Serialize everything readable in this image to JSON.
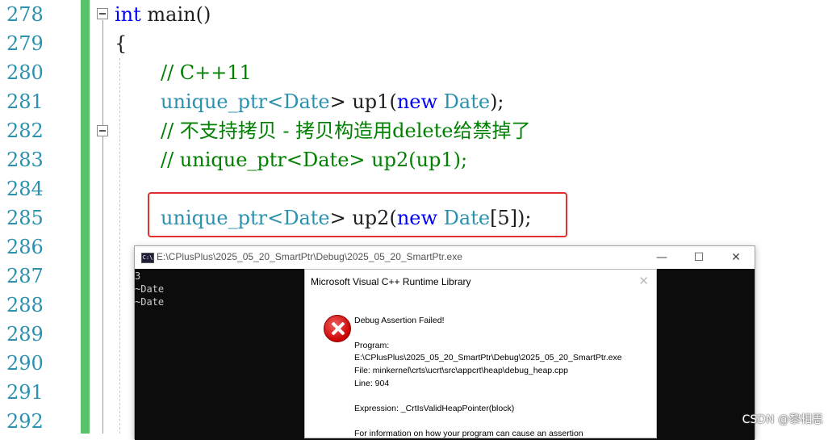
{
  "editor": {
    "line_numbers": [
      "278",
      "279",
      "280",
      "281",
      "282",
      "283",
      "284",
      "285",
      "286",
      "287",
      "288",
      "289",
      "290",
      "291",
      "292"
    ],
    "code": {
      "l278": {
        "kw": "int",
        "rest": " main()"
      },
      "l279": {
        "text": "{"
      },
      "l280": {
        "comment": "// C++11"
      },
      "l281": {
        "t1": "unique_ptr",
        "p1": "<",
        "t2": "Date",
        "p2": "> up1(",
        "kw": "new",
        "sp": " ",
        "t3": "Date",
        "p3": ");"
      },
      "l282": {
        "comment": "// 不支持拷贝 - 拷贝构造用delete给禁掉了"
      },
      "l283": {
        "comment": "// unique_ptr<Date> up2(up1);"
      },
      "l285": {
        "t1": "unique_ptr",
        "p1": "<",
        "t2": "Date",
        "p2": "> up2(",
        "kw": "new",
        "sp": " ",
        "t3": "Date",
        "p3": "[5]);"
      }
    }
  },
  "console": {
    "title": "E:\\CPlusPlus\\2025_05_20_SmartPtr\\Debug\\2025_05_20_SmartPtr.exe",
    "icon_label": "C:\\",
    "minimize": "—",
    "maximize": "☐",
    "close": "✕",
    "output": [
      "3",
      "~Date",
      "~Date"
    ]
  },
  "dialog": {
    "title": "Microsoft Visual C++ Runtime Library",
    "close": "✕",
    "heading": "Debug Assertion Failed!",
    "program_label": "Program:",
    "program_path": "E:\\CPlusPlus\\2025_05_20_SmartPtr\\Debug\\2025_05_20_SmartPtr.exe",
    "file_line": "File: minkernel\\crts\\ucrt\\src\\appcrt\\heap\\debug_heap.cpp",
    "line_no": "Line: 904",
    "expression": "Expression: _CrtIsValidHeapPointer(block)",
    "info_partial": "For information on how your program can cause an assertion"
  },
  "watermark": "CSDN @黎相思",
  "colors": {
    "keyword": "#0000ff",
    "type": "#2b91af",
    "comment": "#008000",
    "highlight_border": "#e23030",
    "change_bar": "#57c36a"
  }
}
